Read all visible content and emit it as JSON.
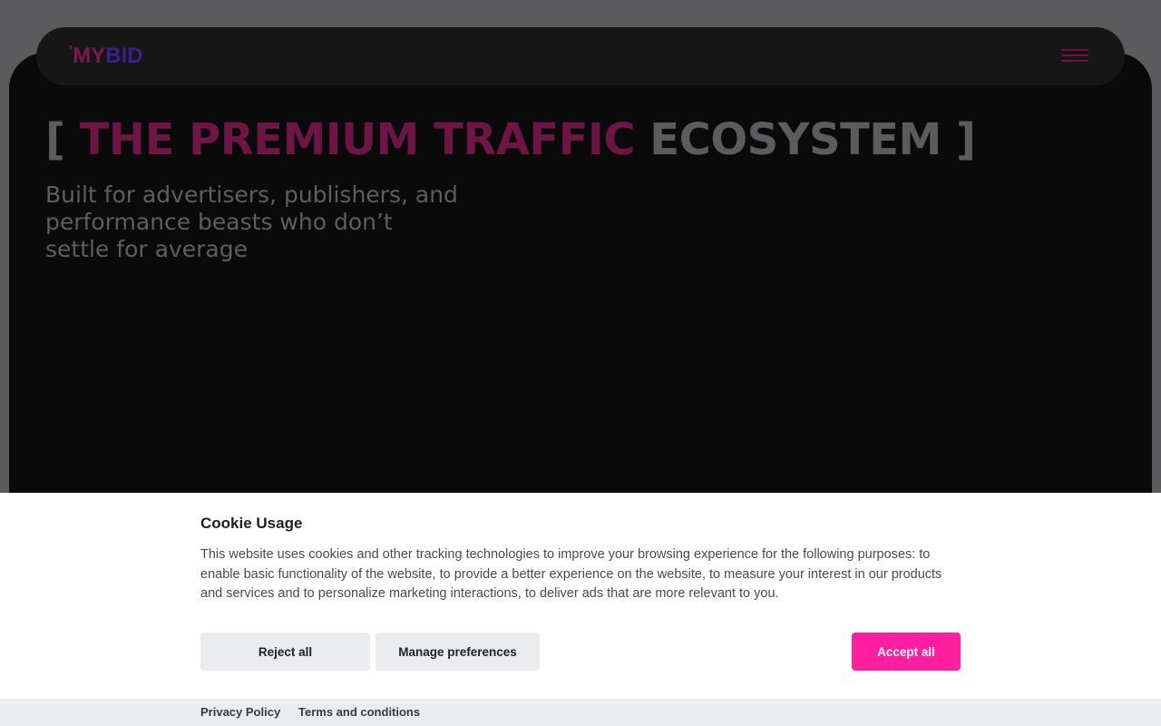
{
  "navbar": {
    "logo_tick": "'",
    "logo_my": "MY",
    "logo_bid": "BID"
  },
  "hero": {
    "headline_open": "[ ",
    "headline_accent": "THE PREMIUM TRAFFIC",
    "headline_rest": " ECOSYSTEM ]",
    "subtitle": "Built for advertisers, publishers, and performance beasts who don’t settle for average"
  },
  "cookie": {
    "title": "Cookie Usage",
    "body": "This website uses cookies and other tracking technologies to improve your browsing experience for the following purposes: to enable basic functionality of the website, to provide a better experience on the website, to measure your interest in our products and services and to personalize marketing interactions, to deliver ads that are more relevant to you.",
    "reject_label": "Reject all",
    "manage_label": "Manage preferences",
    "accept_label": "Accept all",
    "footer": {
      "privacy_label": "Privacy Policy",
      "terms_label": "Terms and conditions"
    }
  },
  "colors": {
    "accent_pink": "#ff1fa0",
    "brand_magenta": "#7a1a4d",
    "brand_violet": "#3b1f8f"
  },
  "icons": {
    "menu": "hamburger-menu-icon"
  }
}
